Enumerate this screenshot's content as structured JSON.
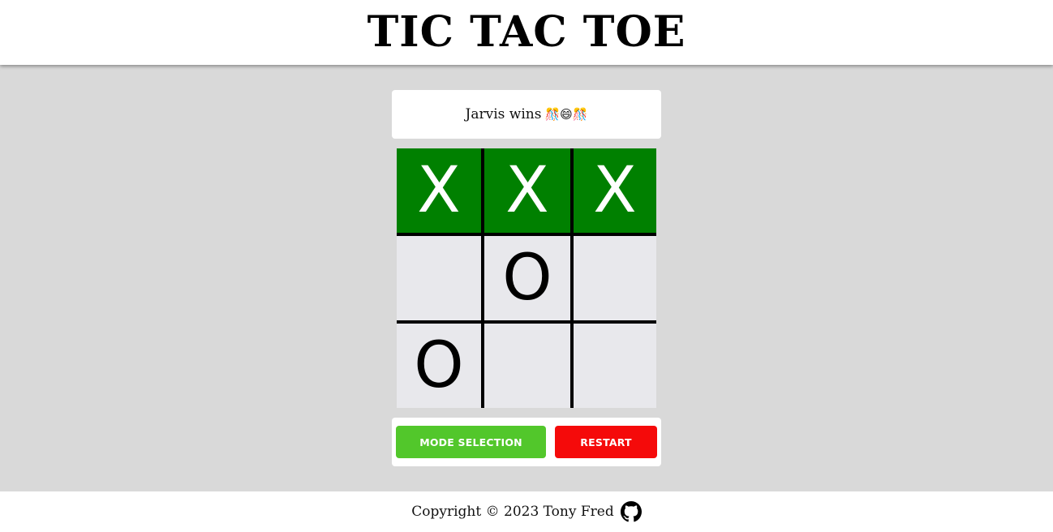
{
  "header": {
    "title": "TIC TAC TOE"
  },
  "status": {
    "text": "Jarvis wins",
    "emoji": "🎊😄🎊"
  },
  "board": {
    "cells": [
      [
        "X",
        "X",
        "X"
      ],
      [
        "",
        "O",
        ""
      ],
      [
        "O",
        "",
        ""
      ]
    ],
    "winning_row": 0,
    "win_color": "#008000",
    "cell_color": "#e8e8ec"
  },
  "controls": {
    "mode_label": "MODE SELECTION",
    "restart_label": "RESTART",
    "mode_color": "#52c72b",
    "restart_color": "#f50a0a"
  },
  "footer": {
    "copyright": "Copyright © 2023 Tony Fred",
    "icon": "github-icon"
  }
}
